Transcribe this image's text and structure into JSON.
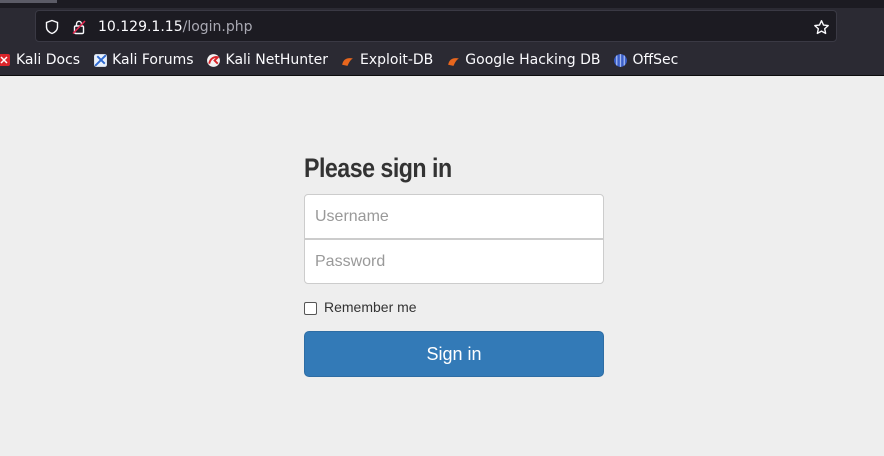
{
  "browser": {
    "url_host": "10.129.1.15",
    "url_path": "/login.php",
    "icons": {
      "tracking_protection": "shield-icon",
      "security": "insecure-lock-icon",
      "bookmark_star": "star-icon"
    },
    "bookmarks": [
      {
        "label": "Kali Docs",
        "icon": "kali-docs-icon"
      },
      {
        "label": "Kali Forums",
        "icon": "kali-forums-icon"
      },
      {
        "label": "Kali NetHunter",
        "icon": "kali-nethunter-icon"
      },
      {
        "label": "Exploit-DB",
        "icon": "exploit-db-icon"
      },
      {
        "label": "Google Hacking DB",
        "icon": "ghdb-icon"
      },
      {
        "label": "OffSec",
        "icon": "offsec-icon"
      }
    ]
  },
  "login": {
    "heading": "Please sign in",
    "username_placeholder": "Username",
    "password_placeholder": "Password",
    "remember_label": "Remember me",
    "remember_checked": false,
    "submit_label": "Sign in"
  },
  "colors": {
    "page_bg": "#eeeeee",
    "chrome_bg": "#2b2a33",
    "primary_button": "#337ab7"
  }
}
